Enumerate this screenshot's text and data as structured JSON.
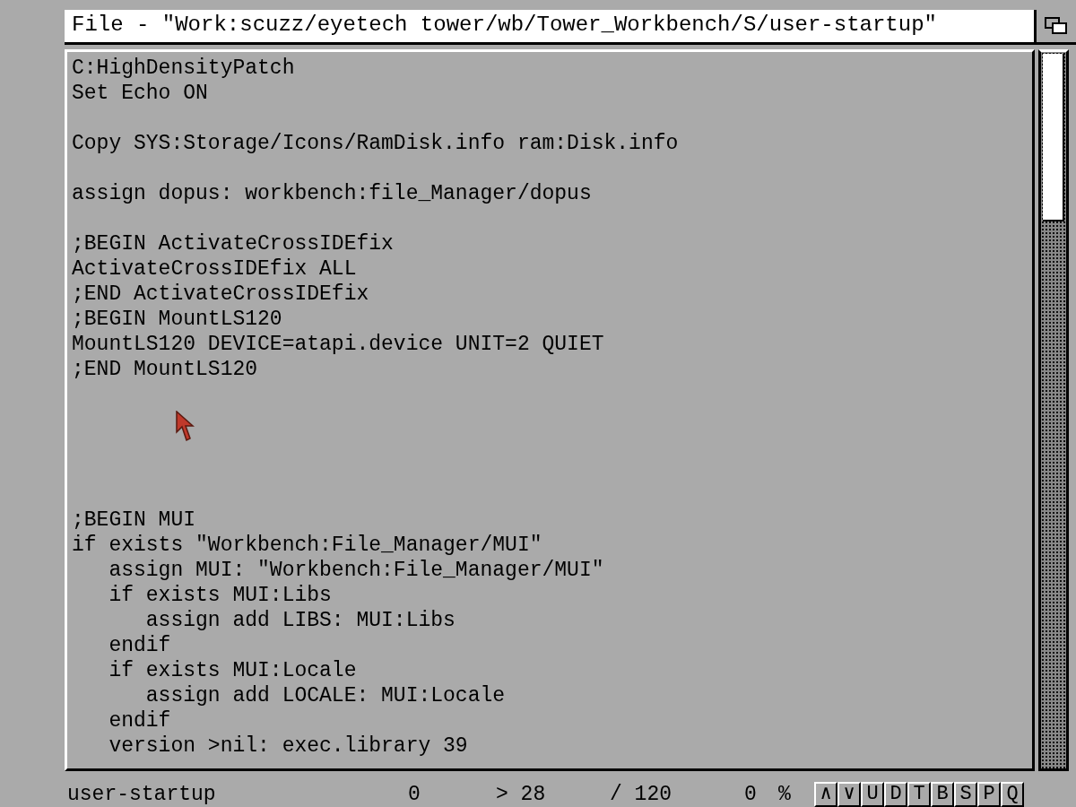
{
  "window": {
    "title": "File - \"Work:scuzz/eyetech tower/wb/Tower_Workbench/S/user-startup\""
  },
  "editor": {
    "lines": [
      {
        "kind": "text",
        "text": "C:HighDensityPatch"
      },
      {
        "kind": "text",
        "text": "Set Echo ON"
      },
      {
        "kind": "blank"
      },
      {
        "kind": "text",
        "text": "Copy SYS:Storage/Icons/RamDisk.info ram:Disk.info"
      },
      {
        "kind": "blank"
      },
      {
        "kind": "text",
        "text": "assign dopus: workbench:file_Manager/dopus"
      },
      {
        "kind": "blank"
      },
      {
        "kind": "text",
        "text": ";BEGIN ActivateCrossIDEfix"
      },
      {
        "kind": "text",
        "text": "ActivateCrossIDEfix ALL"
      },
      {
        "kind": "text",
        "text": ";END ActivateCrossIDEfix"
      },
      {
        "kind": "text",
        "text": ";BEGIN MountLS120"
      },
      {
        "kind": "text",
        "text": "MountLS120 DEVICE=atapi.device UNIT=2 QUIET"
      },
      {
        "kind": "text",
        "text": ";END MountLS120"
      },
      {
        "kind": "blank"
      },
      {
        "kind": "blank"
      },
      {
        "kind": "blank"
      },
      {
        "kind": "blank"
      },
      {
        "kind": "blank"
      },
      {
        "kind": "text",
        "text": ";BEGIN MUI"
      },
      {
        "kind": "text",
        "text": "if exists \"Workbench:File_Manager/MUI\""
      },
      {
        "kind": "text",
        "text": "   assign MUI: \"Workbench:File_Manager/MUI\""
      },
      {
        "kind": "text",
        "text": "   if exists MUI:Libs"
      },
      {
        "kind": "text",
        "text": "      assign add LIBS: MUI:Libs"
      },
      {
        "kind": "text",
        "text": "   endif"
      },
      {
        "kind": "text",
        "text": "   if exists MUI:Locale"
      },
      {
        "kind": "text",
        "text": "      assign add LOCALE: MUI:Locale"
      },
      {
        "kind": "text",
        "text": "   endif"
      },
      {
        "kind": "text",
        "text": "   version >nil: exec.library 39"
      }
    ]
  },
  "status_bar": {
    "filename": "user-startup",
    "column": "0",
    "line": "> 28",
    "total": "/ 120",
    "percent": "0",
    "percent_sign": "%",
    "buttons": [
      "∧",
      "∨",
      "U",
      "D",
      "T",
      "B",
      "S",
      "P",
      "Q"
    ]
  }
}
